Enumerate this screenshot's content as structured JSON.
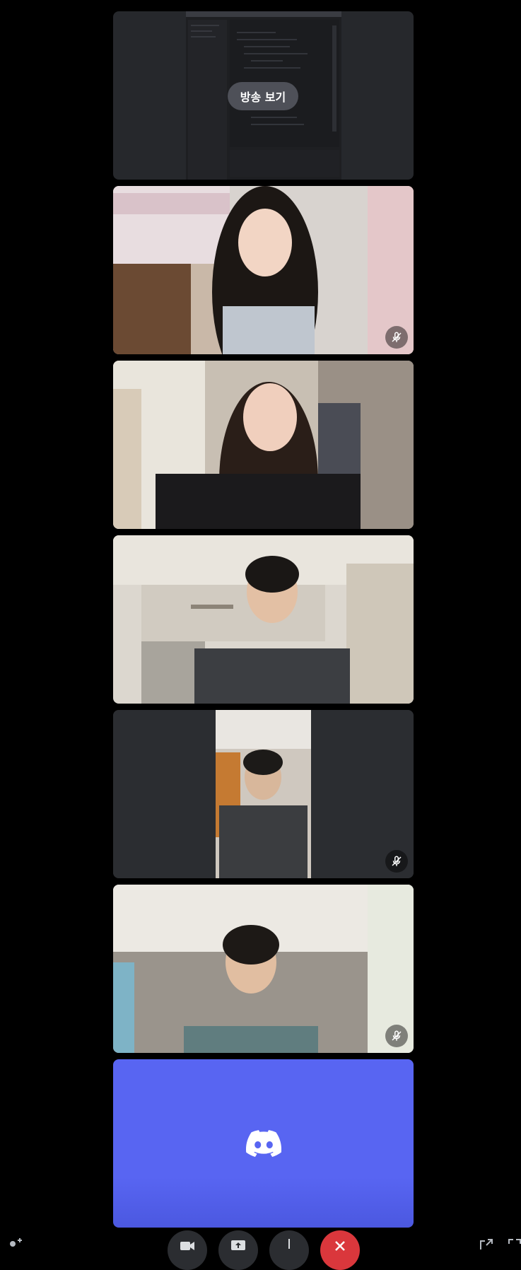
{
  "stream_tile": {
    "watch_stream_label": "방송 보기"
  },
  "participants": [
    {
      "muted": true
    },
    {
      "muted": false
    },
    {
      "muted": false
    },
    {
      "muted": true
    },
    {
      "muted": true
    }
  ],
  "colors": {
    "discord_blurple": "#5865f2",
    "hangup_red": "#da373c",
    "tile_bg": "#2b2d31"
  },
  "icons": [
    "mic-off-icon",
    "discord-logo-icon",
    "camera-icon",
    "screen-share-icon",
    "microphone-icon",
    "hang-up-icon",
    "add-user-icon",
    "popout-icon",
    "fullscreen-icon"
  ]
}
